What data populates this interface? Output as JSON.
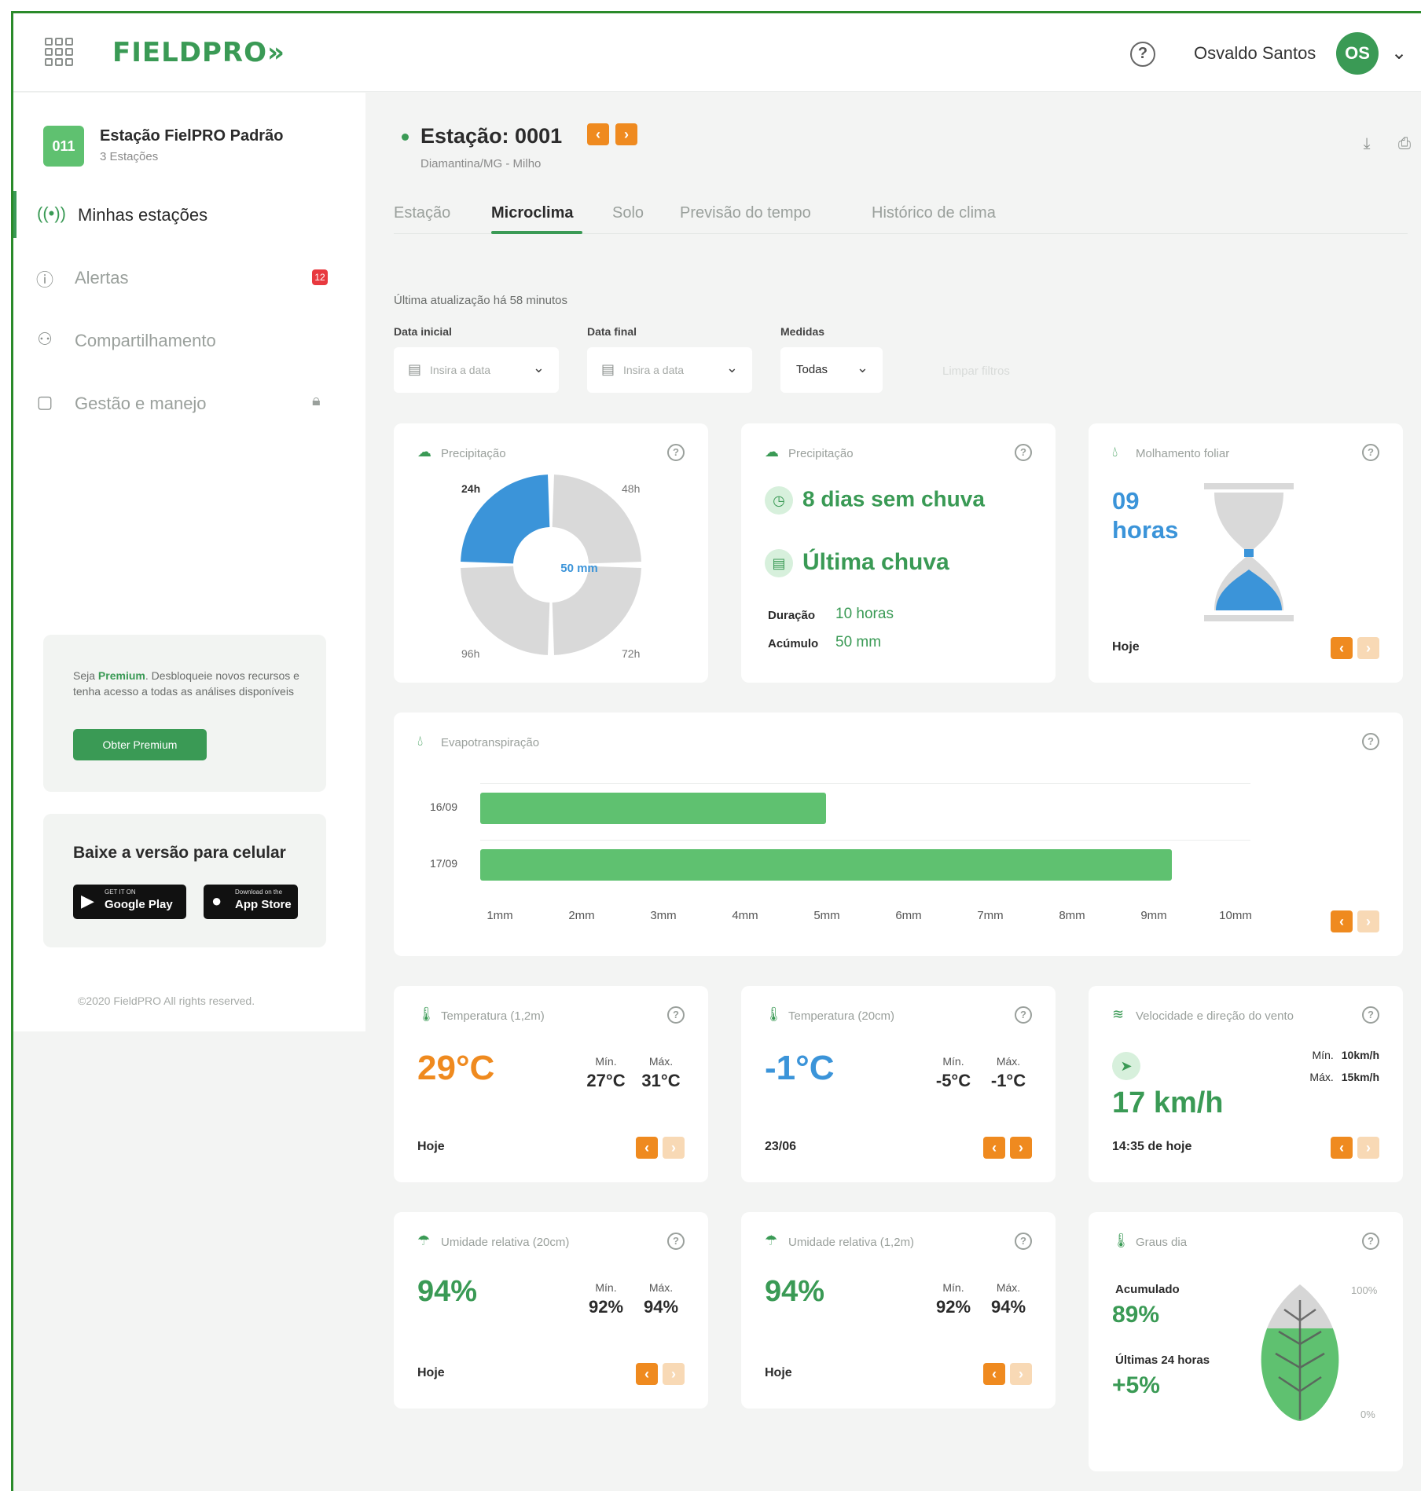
{
  "header": {
    "logo": "FIELDPRO",
    "logo_suffix": "»",
    "help_icon": "help-circle-icon",
    "username": "Osvaldo Santos",
    "avatar_initials": "OS"
  },
  "sidebar": {
    "station_badge": "011",
    "station_name": "Estação FielPRO Padrão",
    "station_sub": "3 Estações",
    "items": [
      {
        "label": "Minhas estações",
        "icon": "antenna-icon",
        "active": true
      },
      {
        "label": "Alertas",
        "icon": "alert-circle-icon",
        "badge": "12"
      },
      {
        "label": "Compartilhamento",
        "icon": "share-user-icon"
      },
      {
        "label": "Gestão e manejo",
        "icon": "clipboard-icon",
        "locked": true
      }
    ],
    "premium": {
      "text_prefix": "Seja ",
      "text_highlight": "Premium",
      "text_suffix": ". Desbloqueie novos recursos e tenha acesso a todas as análises disponíveis",
      "button": "Obter Premium"
    },
    "app_download": {
      "title": "Baixe a versão para celular",
      "google_small": "GET IT ON",
      "google": "Google Play",
      "apple_small": "Download on the",
      "apple": "App Store"
    },
    "copyright": "©2020 FieldPRO All rights reserved."
  },
  "station": {
    "title": "Estação: 0001",
    "location": "Diamantina/MG - Milho"
  },
  "tabs": [
    "Estação",
    "Microclima",
    "Solo",
    "Previsão do tempo",
    "Histórico de clima"
  ],
  "active_tab": "Microclima",
  "last_update": "Última atualização há 58 minutos",
  "filters": {
    "start_label": "Data inicial",
    "start_placeholder": "Insira a data",
    "end_label": "Data final",
    "end_placeholder": "Insira a data",
    "measures_label": "Medidas",
    "measures_value": "Todas",
    "clear": "Limpar filtros"
  },
  "cards": {
    "precip_donut": {
      "title": "Precipitação",
      "center": "50 mm",
      "labels": [
        "24h",
        "48h",
        "72h",
        "96h"
      ]
    },
    "precip_rain": {
      "title": "Precipitação",
      "days_without": "8 dias sem chuva",
      "last_rain": "Última chuva",
      "duration_label": "Duração",
      "duration_value": "10 horas",
      "accum_label": "Acúmulo",
      "accum_value": "50 mm"
    },
    "leaf_wetness": {
      "title": "Molhamento foliar",
      "value": "09 horas",
      "foot": "Hoje"
    },
    "evapo": {
      "title": "Evapotranspiração"
    },
    "temp_12": {
      "title": "Temperatura (1,2m)",
      "value": "29°C",
      "min_label": "Mín.",
      "min": "27°C",
      "max_label": "Máx.",
      "max": "31°C",
      "foot": "Hoje"
    },
    "temp_20": {
      "title": "Temperatura (20cm)",
      "value": "-1°C",
      "min_label": "Mín.",
      "min": "-5°C",
      "max_label": "Máx.",
      "max": "-1°C",
      "foot": "23/06"
    },
    "wind": {
      "title": "Velocidade e direção do vento",
      "value": "17 km/h",
      "min_label": "Mín.",
      "min": "10km/h",
      "max_label": "Máx.",
      "max": "15km/h",
      "foot": "14:35 de hoje"
    },
    "humidity_20": {
      "title": "Umidade relativa (20cm)",
      "value": "94%",
      "min_label": "Mín.",
      "min": "92%",
      "max_label": "Máx.",
      "max": "94%",
      "foot": "Hoje"
    },
    "humidity_12": {
      "title": "Umidade relativa (1,2m)",
      "value": "94%",
      "min_label": "Mín.",
      "min": "92%",
      "max_label": "Máx.",
      "max": "94%",
      "foot": "Hoje"
    },
    "degree_days": {
      "title": "Graus dia",
      "accum_label": "Acumulado",
      "accum_value": "89%",
      "last_label": "Últimas 24 horas",
      "last_value": "+5%",
      "top_pct": "100%",
      "bottom_pct": "0%"
    }
  },
  "chart_data": [
    {
      "type": "pie",
      "title": "Precipitação",
      "categories": [
        "24h",
        "48h",
        "72h",
        "96h"
      ],
      "values": [
        25,
        25,
        25,
        25
      ],
      "highlighted": "24h",
      "center_label": "50 mm"
    },
    {
      "type": "bar",
      "orientation": "horizontal",
      "title": "Evapotranspiração",
      "categories": [
        "16/09",
        "17/09"
      ],
      "values": [
        4.4,
        8.8
      ],
      "x_ticks": [
        "1mm",
        "2mm",
        "3mm",
        "4mm",
        "5mm",
        "6mm",
        "7mm",
        "8mm",
        "9mm",
        "10mm"
      ],
      "xlim": [
        0,
        10
      ]
    }
  ],
  "colors": {
    "brand_green": "#3a9a55",
    "bar_green": "#5fc170",
    "accent_orange": "#ef8a1f",
    "accent_blue": "#3b94d9",
    "alert_red": "#e8393f"
  }
}
